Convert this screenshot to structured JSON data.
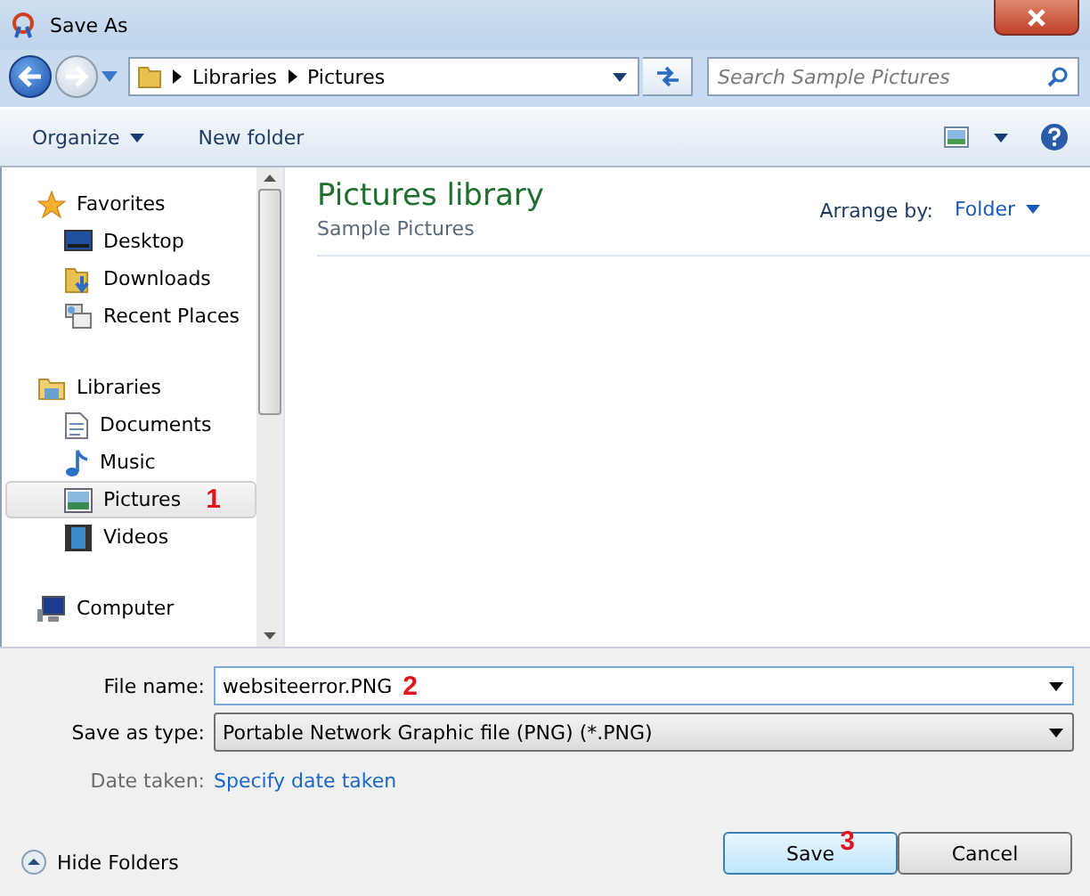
{
  "window": {
    "title": "Save As"
  },
  "address": {
    "crumbs": [
      "Libraries",
      "Pictures"
    ]
  },
  "search": {
    "placeholder": "Search Sample Pictures"
  },
  "toolbar": {
    "organize": "Organize",
    "new_folder": "New folder"
  },
  "sidebar": {
    "groups": [
      {
        "label": "Favorites",
        "kind": "star",
        "children": [
          {
            "label": "Desktop",
            "kind": "desktop",
            "selected": false
          },
          {
            "label": "Downloads",
            "kind": "downloads",
            "selected": false
          },
          {
            "label": "Recent Places",
            "kind": "recent",
            "selected": false
          }
        ]
      },
      {
        "label": "Libraries",
        "kind": "library",
        "children": [
          {
            "label": "Documents",
            "kind": "document",
            "selected": false
          },
          {
            "label": "Music",
            "kind": "music",
            "selected": false
          },
          {
            "label": "Pictures",
            "kind": "picture",
            "selected": true,
            "marker": "1"
          },
          {
            "label": "Videos",
            "kind": "video",
            "selected": false
          }
        ]
      },
      {
        "label": "Computer",
        "kind": "computer"
      }
    ]
  },
  "library": {
    "title": "Pictures library",
    "subtitle": "Sample Pictures",
    "arrange_label": "Arrange by:",
    "arrange_value": "Folder"
  },
  "form": {
    "file_name": {
      "label": "File name:",
      "value": "websiteerror.PNG",
      "marker": "2"
    },
    "save_type": {
      "label": "Save as type:",
      "value": "Portable Network Graphic file (PNG) (*.PNG)"
    },
    "date_taken": {
      "label": "Date taken:",
      "link": "Specify date taken"
    }
  },
  "footer": {
    "hide_folders": "Hide Folders",
    "save": "Save",
    "save_marker": "3",
    "cancel": "Cancel"
  }
}
